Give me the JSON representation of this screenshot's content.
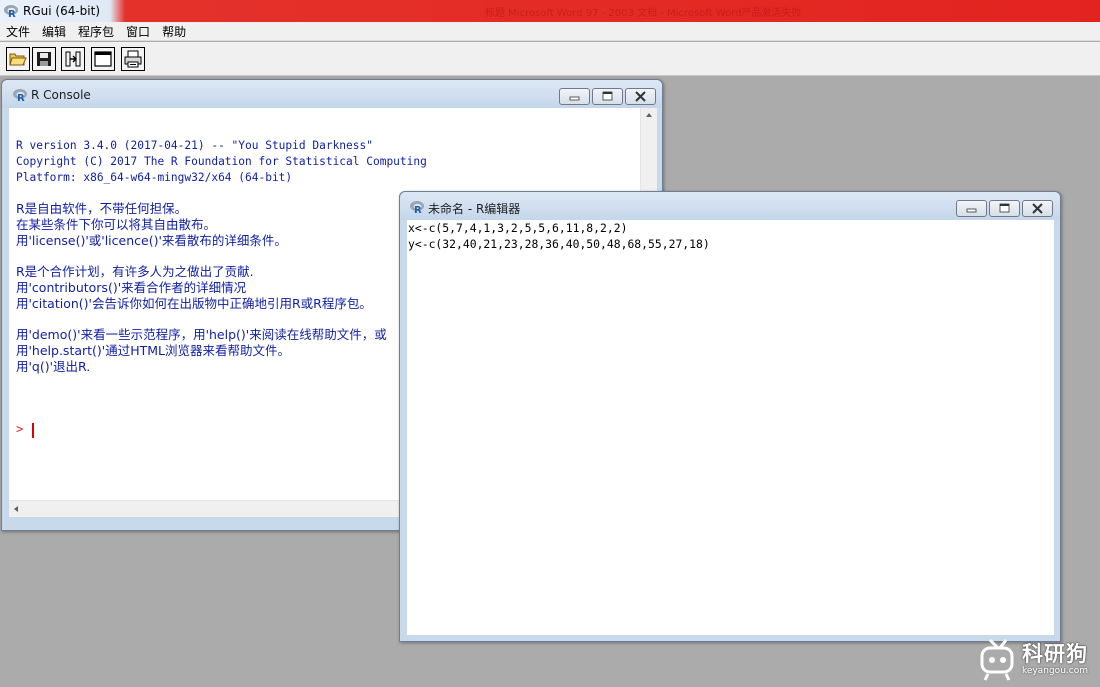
{
  "app": {
    "title": "RGui (64-bit)",
    "icon": "r-logo-icon",
    "background_window_title": "标题 Microsoft Word 97 - 2003 文档 - Microsoft Word产品激活失败"
  },
  "menu": {
    "items": [
      "文件",
      "编辑",
      "程序包",
      "窗口",
      "帮助"
    ]
  },
  "toolbar": {
    "buttons": [
      {
        "icon": "open-folder-icon"
      },
      {
        "icon": "save-disk-icon"
      },
      {
        "icon": "load-workspace-icon"
      },
      {
        "icon": "console-window-icon"
      },
      {
        "icon": "print-icon"
      }
    ]
  },
  "console": {
    "title": "R Console",
    "lines": [
      "R version 3.4.0 (2017-04-21) -- \"You Stupid Darkness\"",
      "Copyright (C) 2017 The R Foundation for Statistical Computing",
      "Platform: x86_64-w64-mingw32/x64 (64-bit)",
      "R是自由软件，不带任何担保。",
      "在某些条件下你可以将其自由散布。",
      "用'license()'或'licence()'来看散布的详细条件。",
      "R是个合作计划，有许多人为之做出了贡献.",
      "用'contributors()'来看合作者的详细情况",
      "用'citation()'会告诉你如何在出版物中正确地引用R或R程序包。",
      "用'demo()'来看一些示范程序，用'help()'来阅读在线帮助文件，或",
      "用'help.start()'通过HTML浏览器来看帮助文件。",
      "用'q()'退出R."
    ],
    "prompt": ">"
  },
  "editor": {
    "title": "未命名 - R编辑器",
    "lines": [
      "x<-c(5,7,4,1,3,2,5,5,6,11,8,2,2)",
      "y<-c(32,40,21,23,28,36,40,50,48,68,55,27,18)"
    ]
  },
  "watermark": {
    "text": "科研狗",
    "url": "keyangou.com"
  },
  "colors": {
    "console_text": "#0f1fa3",
    "prompt": "#dd2222",
    "workspace": "#ababab",
    "titlebar_red": "#e3231f"
  }
}
